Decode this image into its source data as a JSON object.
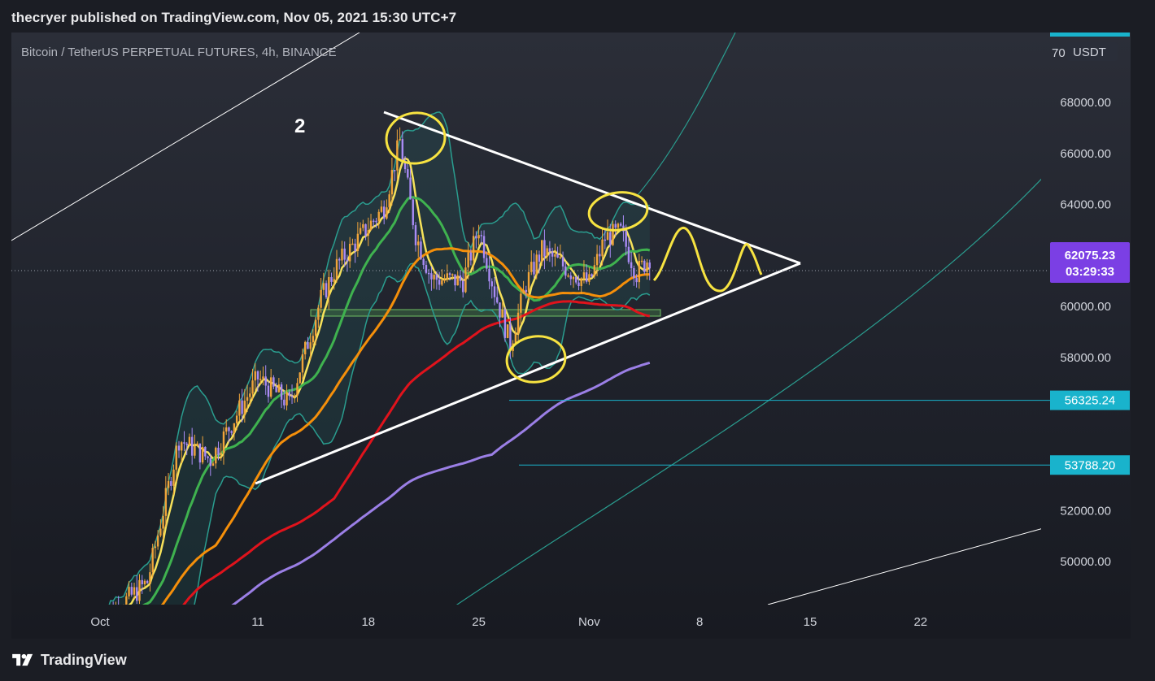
{
  "header": {
    "publish_line": "thecryer published on TradingView.com, Nov 05, 2021 15:30 UTC+7"
  },
  "footer": {
    "brand": "TradingView"
  },
  "colors": {
    "background": "#1b1d24",
    "candle_up": "#f0a43a",
    "candle_down": "#a98bf5",
    "ema_yellow": "#f6e25a",
    "ema_green": "#3fb24f",
    "ema_orange": "#f58f0a",
    "ema_red": "#e0131c",
    "ema_purple": "#9b7fe6",
    "bollinger": "#2a9d8f",
    "trendline": "#ffffff",
    "cyan_label": "#19b3cc",
    "price_label": "#7b3fe4",
    "annotation": "#f7e341"
  },
  "chart_data": {
    "type": "candlestick",
    "title": "Bitcoin / TetherUS PERPETUAL FUTURES, 4h, BINANCE",
    "currency": "USDT",
    "currency_tick_partial": "70",
    "annotation_text": "2",
    "x_ticks": [
      "Oct",
      "11",
      "18",
      "25",
      "Nov",
      "8",
      "15",
      "22"
    ],
    "y_ticks": [
      "68000.00",
      "66000.00",
      "64000.00",
      "60000.00",
      "58000.00",
      "52000.00",
      "50000.00"
    ],
    "ylim": [
      48500,
      70500
    ],
    "current_price": {
      "value": "62075.23",
      "countdown": "03:29:33"
    },
    "price_levels": [
      {
        "value": "56325.24",
        "y": 56325.24
      },
      {
        "value": "53788.20",
        "y": 53788.2
      }
    ],
    "candles_close_approx": [
      {
        "date": "2021-10-01",
        "close": 47600
      },
      {
        "date": "2021-10-04",
        "close": 49200
      },
      {
        "date": "2021-10-06",
        "close": 54800
      },
      {
        "date": "2021-10-08",
        "close": 54000
      },
      {
        "date": "2021-10-11",
        "close": 57200
      },
      {
        "date": "2021-10-13",
        "close": 56200
      },
      {
        "date": "2021-10-15",
        "close": 60300
      },
      {
        "date": "2021-10-16",
        "close": 61600
      },
      {
        "date": "2021-10-19",
        "close": 63900
      },
      {
        "date": "2021-10-20",
        "close": 66500
      },
      {
        "date": "2021-10-21",
        "close": 62800
      },
      {
        "date": "2021-10-22",
        "close": 61100
      },
      {
        "date": "2021-10-24",
        "close": 61000
      },
      {
        "date": "2021-10-25",
        "close": 63100
      },
      {
        "date": "2021-10-26",
        "close": 60600
      },
      {
        "date": "2021-10-27",
        "close": 58500
      },
      {
        "date": "2021-10-28",
        "close": 60900
      },
      {
        "date": "2021-10-29",
        "close": 62200
      },
      {
        "date": "2021-10-31",
        "close": 61300
      },
      {
        "date": "2021-11-01",
        "close": 60900
      },
      {
        "date": "2021-11-02",
        "close": 62700
      },
      {
        "date": "2021-11-03",
        "close": 62900
      },
      {
        "date": "2021-11-04",
        "close": 61300
      },
      {
        "date": "2021-11-05",
        "close": 62075
      }
    ]
  }
}
